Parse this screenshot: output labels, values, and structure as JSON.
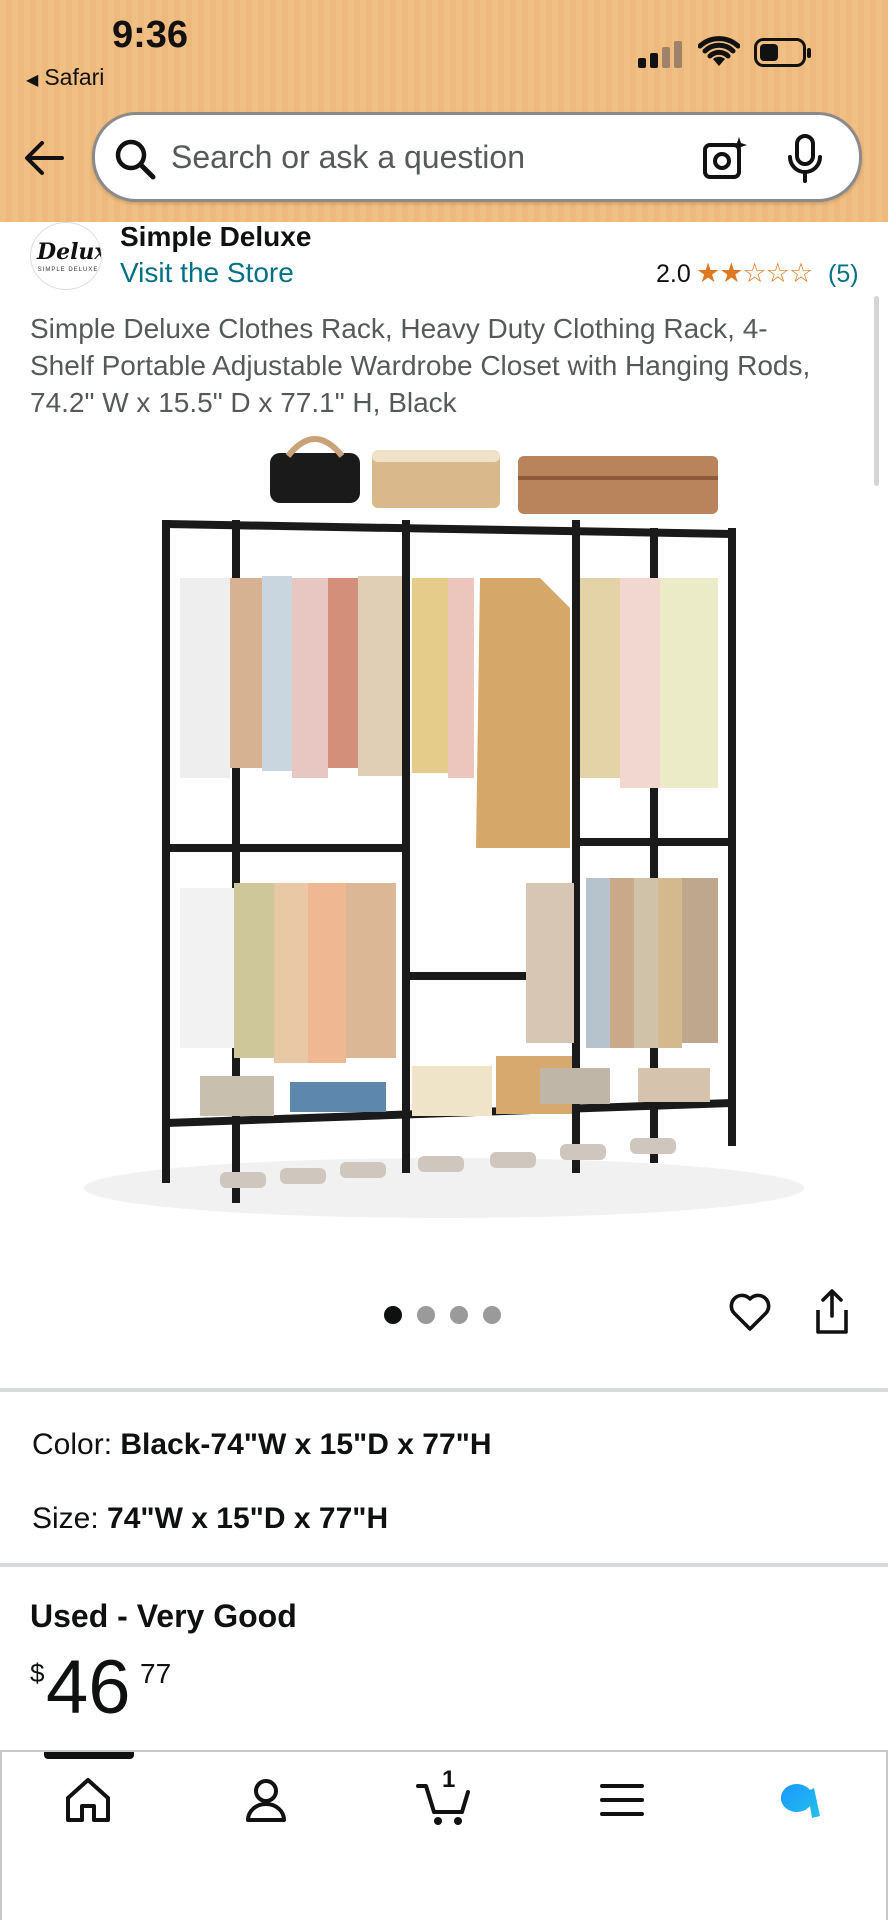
{
  "status_bar": {
    "time": "9:36",
    "back_app": "Safari"
  },
  "search": {
    "placeholder": "Search or ask a question"
  },
  "store": {
    "logo_text": "Deluxe",
    "logo_subtext": "SIMPLE DELUXE",
    "name": "Simple Deluxe",
    "visit_label": "Visit the Store",
    "rating": "2.0",
    "rating_stars_filled": 2,
    "rating_stars_total": 5,
    "review_count": "(5)"
  },
  "product": {
    "title": "Simple Deluxe Clothes Rack, Heavy Duty Clothing Rack, 4-Shelf Portable Adjustable Wardrobe Closet with Hanging Rods, 74.2\" W x 15.5\" D x 77.1\" H, Black",
    "image_alt": "Black metal clothes rack with hanging clothes and shelves",
    "image_count": 4,
    "image_index": 1
  },
  "options": {
    "color_label": "Color:",
    "color_value": "Black-74\"W x 15\"D x 77\"H",
    "size_label": "Size:",
    "size_value": "74\"W x 15\"D x 77\"H"
  },
  "offer": {
    "condition": "Used - Very Good",
    "currency": "$",
    "price_whole": "46",
    "price_fraction": "77"
  },
  "bottom_nav": {
    "items": [
      "home-icon",
      "account-icon",
      "cart-icon",
      "menu-icon",
      "rufus-icon"
    ],
    "cart_count": "1"
  },
  "colors": {
    "header_bg": "#f0bf84",
    "link": "#007185",
    "star": "#de7921",
    "text": "#0f1111",
    "secondary_text": "#565959",
    "alexa_blue": "#1a98ff"
  }
}
